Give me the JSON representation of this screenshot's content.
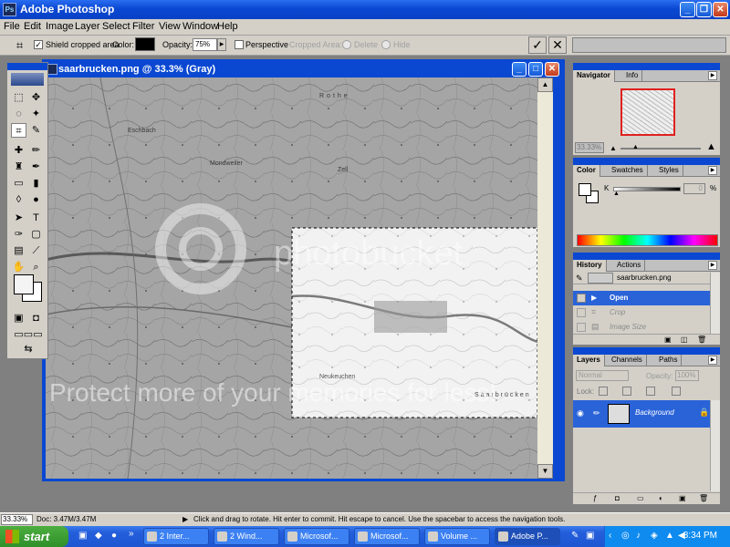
{
  "app": {
    "title": "Adobe Photoshop"
  },
  "menu": [
    "File",
    "Edit",
    "Image",
    "Layer",
    "Select",
    "Filter",
    "View",
    "Window",
    "Help"
  ],
  "options": {
    "shield_label": "Shield cropped area",
    "color_label": "Color:",
    "color_value": "#000000",
    "opacity_label": "Opacity:",
    "opacity_value": "75%",
    "perspective_label": "Perspective",
    "cropped_area_label": "Cropped Area:",
    "delete_label": "Delete",
    "hide_label": "Hide",
    "commit_icon": "check-icon",
    "cancel_icon": "cancel-icon"
  },
  "document": {
    "title": "saarbrucken.png @ 33.3% (Gray)",
    "map_labels": [
      "Saarbrücken",
      "Zell",
      "Rothe",
      "Mondweiler",
      "Eschbach",
      "Neukeuchen"
    ],
    "watermark_line1": "photobucket",
    "watermark_line2": "Protect more of your memories for less!"
  },
  "navigator": {
    "tabs": [
      "Navigator",
      "Info"
    ],
    "zoom": "33.33%"
  },
  "color_palette": {
    "tabs": [
      "Color",
      "Swatches",
      "Styles"
    ],
    "channel_label": "K",
    "value": "0",
    "unit": "%"
  },
  "history": {
    "tabs": [
      "History",
      "Actions"
    ],
    "snapshot": "saarbrucken.png",
    "items": [
      {
        "label": "Open",
        "state": "selected"
      },
      {
        "label": "Crop",
        "state": "dimmed"
      },
      {
        "label": "Image Size",
        "state": "dimmed"
      }
    ]
  },
  "layers": {
    "tabs": [
      "Layers",
      "Channels",
      "Paths"
    ],
    "blend_mode": "Normal",
    "opacity_label": "Opacity:",
    "opacity_value": "100%",
    "lock_label": "Lock:",
    "layer_name": "Background"
  },
  "status": {
    "zoom": "33.33%",
    "doc": "Doc: 3.47M/3.47M",
    "hint": "Click and drag to rotate. Hit enter to commit. Hit escape to cancel. Use the spacebar to access the navigation tools."
  },
  "taskbar": {
    "start": "start",
    "tasks": [
      {
        "label": "2 Inter..."
      },
      {
        "label": "2 Wind..."
      },
      {
        "label": "Microsof..."
      },
      {
        "label": "Microsof..."
      },
      {
        "label": "Volume ..."
      },
      {
        "label": "Adobe P..."
      }
    ],
    "clock": "8:34 PM"
  },
  "colors": {
    "xp_blue": "#0a48d2",
    "selection": "#2a63d8",
    "dialog_gray": "#d4d0c8"
  }
}
